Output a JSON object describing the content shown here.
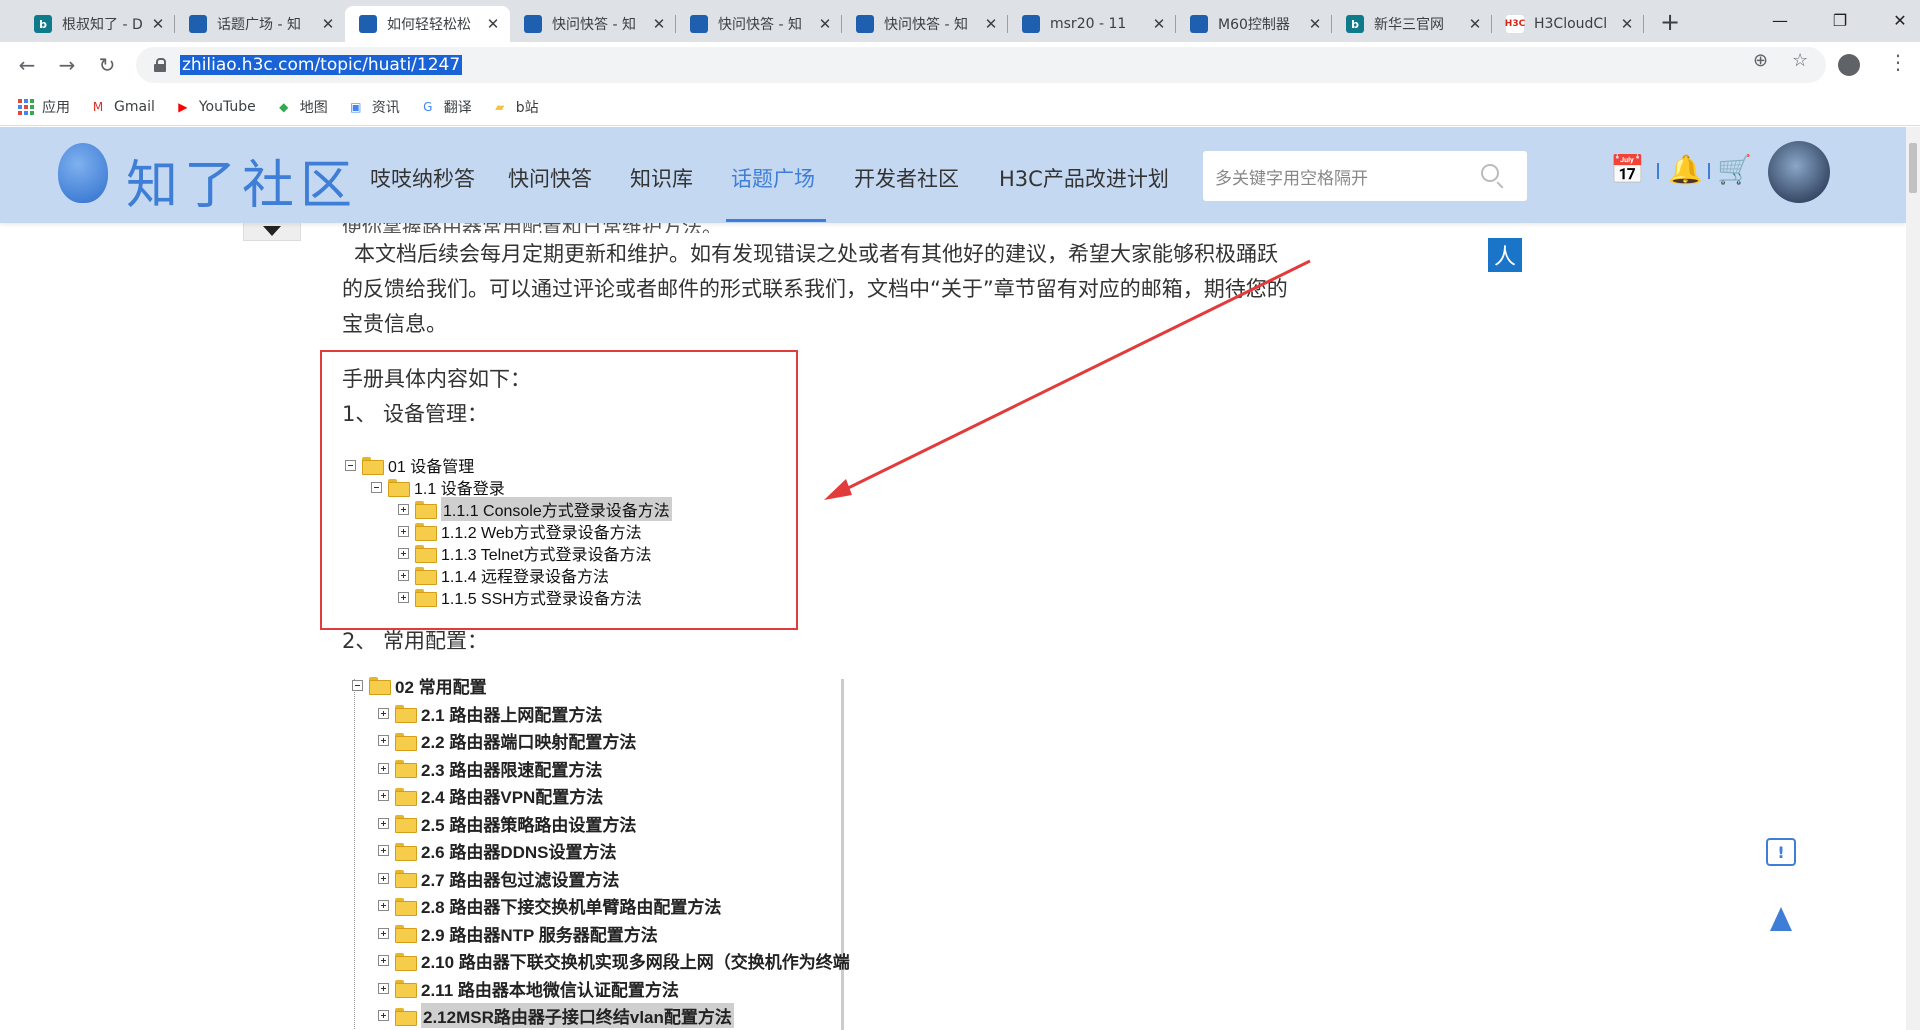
{
  "browser": {
    "tabs": [
      {
        "title": "根叔知了 - D",
        "icon": "bing-icon",
        "active": false
      },
      {
        "title": "话题广场 - 知",
        "icon": "zhiliao-icon",
        "active": false
      },
      {
        "title": "如何轻轻松松",
        "icon": "zhiliao-icon",
        "active": true
      },
      {
        "title": "快问快答 - 知",
        "icon": "zhiliao-icon",
        "active": false
      },
      {
        "title": "快问快答 - 知",
        "icon": "zhiliao-icon",
        "active": false
      },
      {
        "title": "快问快答 - 知",
        "icon": "zhiliao-icon",
        "active": false
      },
      {
        "title": "msr20 - 11",
        "icon": "zhiliao-icon",
        "active": false
      },
      {
        "title": "M60控制器",
        "icon": "zhiliao-icon",
        "active": false
      },
      {
        "title": "新华三官网",
        "icon": "bing-icon",
        "active": false
      },
      {
        "title": "H3CloudCl",
        "icon": "h3c-icon",
        "active": false
      }
    ],
    "new_tab": "+",
    "url": "zhiliao.h3c.com/topic/huati/1247",
    "bookmarks": [
      {
        "label": "应用",
        "icon": "apps-icon"
      },
      {
        "label": "Gmail",
        "icon": "gmail-icon"
      },
      {
        "label": "YouTube",
        "icon": "youtube-icon"
      },
      {
        "label": "地图",
        "icon": "maps-icon"
      },
      {
        "label": "资讯",
        "icon": "news-icon"
      },
      {
        "label": "翻译",
        "icon": "translate-icon"
      },
      {
        "label": "b站",
        "icon": "folder-icon"
      }
    ]
  },
  "site": {
    "logo_text": "知了社区",
    "nav": [
      "吱吱纳秒答",
      "快问快答",
      "知识库",
      "话题广场",
      "开发者社区",
      "H3C产品改进计划"
    ],
    "active_nav": "话题广场",
    "search_placeholder": "多关键字用空格隔开",
    "colors": {
      "header_bg": "#c5d8f1",
      "accent": "#3f7ed6",
      "highlight_box": "#e23b3b"
    }
  },
  "article": {
    "cut_line": "便你掌握路由器常用配置和日常维护方法。",
    "paragraph": "本文档后续会每月定期更新和维护。如有发现错误之处或者有其他好的建议，希望大家能够积极踊跃的反馈给我们。可以通过评论或者邮件的形式联系我们，文档中“关于”章节留有对应的邮箱，期待您的宝贵信息。",
    "intro": "手册具体内容如下：",
    "section1": "1、 设备管理：",
    "section2": "2、 常用配置："
  },
  "tree1": {
    "root": "01 设备管理",
    "child": "1.1 设备登录",
    "items": [
      "1.1.1 Console方式登录设备方法",
      "1.1.2 Web方式登录设备方法",
      "1.1.3 Telnet方式登录设备方法",
      "1.1.4 远程登录设备方法",
      "1.1.5 SSH方式登录设备方法"
    ]
  },
  "tree2": {
    "root": "02 常用配置",
    "items": [
      "2.1 路由器上网配置方法",
      "2.2 路由器端口映射配置方法",
      "2.3 路由器限速配置方法",
      "2.4 路由器VPN配置方法",
      "2.5 路由器策略路由设置方法",
      "2.6 路由器DDNS设置方法",
      "2.7 路由器包过滤设置方法",
      "2.8 路由器下接交换机单臂路由配置方法",
      "2.9 路由器NTP 服务器配置方法",
      "2.10 路由器下联交换机实现多网段上网（交换机作为终端",
      "2.11 路由器本地微信认证配置方法",
      "2.12MSR路由器子接口终结vlan配置方法"
    ]
  },
  "floating": {
    "ren_label": "人",
    "feedback_label": "!"
  }
}
